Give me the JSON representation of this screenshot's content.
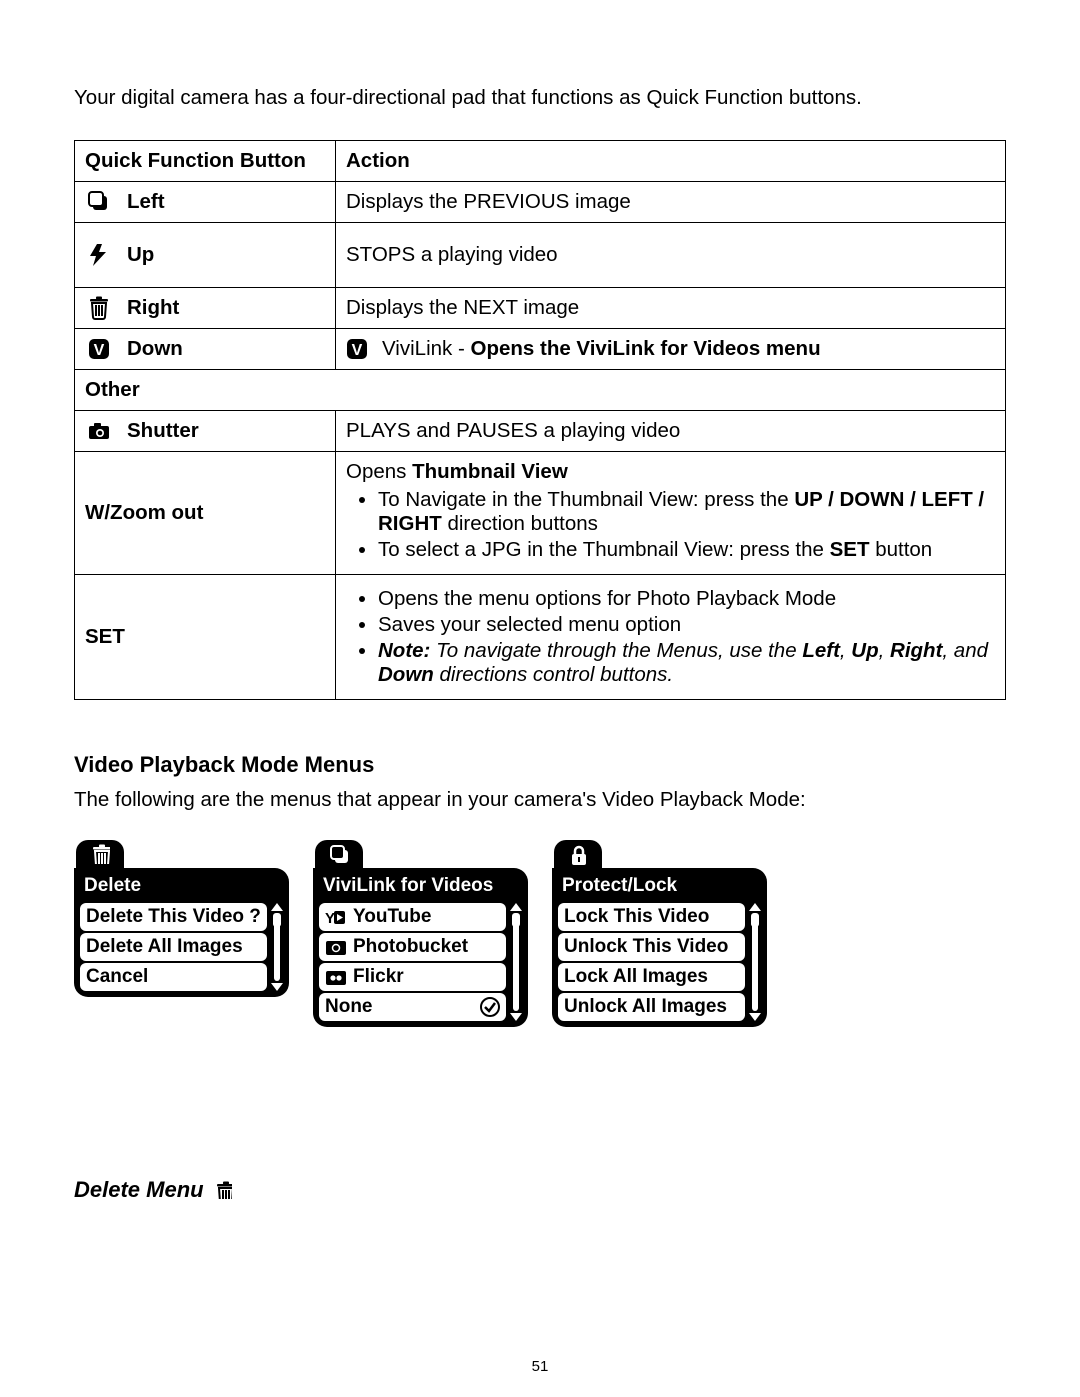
{
  "intro": "Your digital camera has a four-directional pad that functions as Quick Function buttons.",
  "table": {
    "headers": {
      "col1": "Quick Function Button",
      "col2": "Action"
    },
    "left": {
      "label": "Left",
      "action": "Displays the PREVIOUS image"
    },
    "up": {
      "label": "Up",
      "action": "STOPS a playing video"
    },
    "right": {
      "label": "Right",
      "action": "Displays the NEXT image"
    },
    "down": {
      "label": "Down",
      "action_prefix": "ViviLink - ",
      "action_bold": "Opens the ViviLink for Videos menu"
    },
    "other_header": "Other",
    "shutter": {
      "label": "Shutter",
      "action": "PLAYS and PAUSES a playing video"
    },
    "wzoom": {
      "label": "W/Zoom out",
      "line1_prefix": "Opens ",
      "line1_bold": "Thumbnail View",
      "b1_prefix": "To Navigate in the Thumbnail View: press the ",
      "b1_bold1": "UP / DOWN / LEFT / RIGHT",
      "b1_suffix": " direction buttons",
      "b2_prefix": "To select a JPG in the Thumbnail View: press the ",
      "b2_bold": "SET",
      "b2_suffix": " button"
    },
    "set": {
      "label": "SET",
      "b1": "Opens the menu options for Photo Playback Mode",
      "b2": "Saves your selected menu option",
      "b3_note": "Note:",
      "b3_text1": " To navigate through the Menus, use the ",
      "b3_bold1": "Left",
      "b3_c1": ", ",
      "b3_bold2": "Up",
      "b3_c2": ", ",
      "b3_bold3": "Right",
      "b3_c3": ", and ",
      "b3_bold4": "Down",
      "b3_text2": " directions control buttons."
    }
  },
  "section": {
    "title": "Video Playback Mode Menus",
    "sub": "The following are the menus that appear in your camera's Video Playback Mode:"
  },
  "menus": {
    "delete": {
      "title": "Delete",
      "items": [
        "Delete This Video ?",
        "Delete All Images",
        "Cancel"
      ]
    },
    "vivilink": {
      "title": "ViviLink for Videos",
      "items": [
        "YouTube",
        "Photobucket",
        "Flickr",
        "None"
      ]
    },
    "protect": {
      "title": "Protect/Lock",
      "items": [
        "Lock This Video",
        "Unlock This Video",
        "Lock All Images",
        "Unlock All Images"
      ]
    }
  },
  "delete_menu_heading": "Delete Menu",
  "page_number": "51"
}
